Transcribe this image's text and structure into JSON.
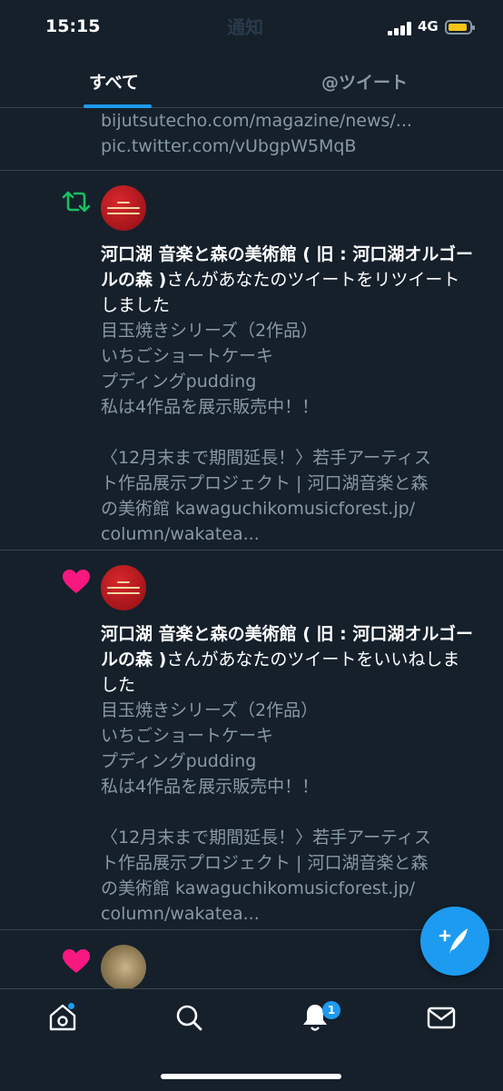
{
  "status_bar": {
    "time": "15:15",
    "network": "4G",
    "ghost_title": "通知"
  },
  "tabs": [
    {
      "label": "すべて"
    },
    {
      "label": "@ツイート"
    }
  ],
  "previous_tail": {
    "line1": "bijutsutecho.com/magazine/news/...",
    "line2": "pic.twitter.com/vUbgpW5MqB"
  },
  "notifications": [
    {
      "type": "retweet",
      "icon": "retweet-icon",
      "actor": "河口湖 音楽と森の美術館 ( 旧 : 河口湖オルゴールの森 )",
      "action": "さんがあなたのツイートをリツイートしました",
      "body": [
        "目玉焼きシリーズ（2作品）",
        "いちごショートケーキ",
        "プディングpudding",
        "私は4作品を展示販売中！！",
        "",
        "〈12月末まで期間延長！〉若手アーティス",
        "ト作品展示プロジェクト | 河口湖音楽と森",
        "の美術館 kawaguchikomusicforest.jp/",
        "column/wakatea..."
      ]
    },
    {
      "type": "like",
      "icon": "heart-icon",
      "actor": "河口湖 音楽と森の美術館 ( 旧 : 河口湖オルゴールの森 )",
      "action": "さんがあなたのツイートをいいねしました",
      "body": [
        "目玉焼きシリーズ（2作品）",
        "いちごショートケーキ",
        "プディングpudding",
        "私は4作品を展示販売中！！",
        "",
        "〈12月末まで期間延長！〉若手アーティス",
        "ト作品展示プロジェクト | 河口湖音楽と森",
        "の美術館 kawaguchikomusicforest.jp/",
        "column/wakatea..."
      ]
    }
  ],
  "bottom_nav": {
    "items": [
      "home-icon",
      "search-icon",
      "notifications-icon",
      "messages-icon"
    ],
    "notifications_badge": "1"
  },
  "colors": {
    "background": "#15202b",
    "accent": "#1d9bf0",
    "retweet": "#17bf63",
    "like": "#f91880",
    "muted_text": "#8899a6"
  }
}
